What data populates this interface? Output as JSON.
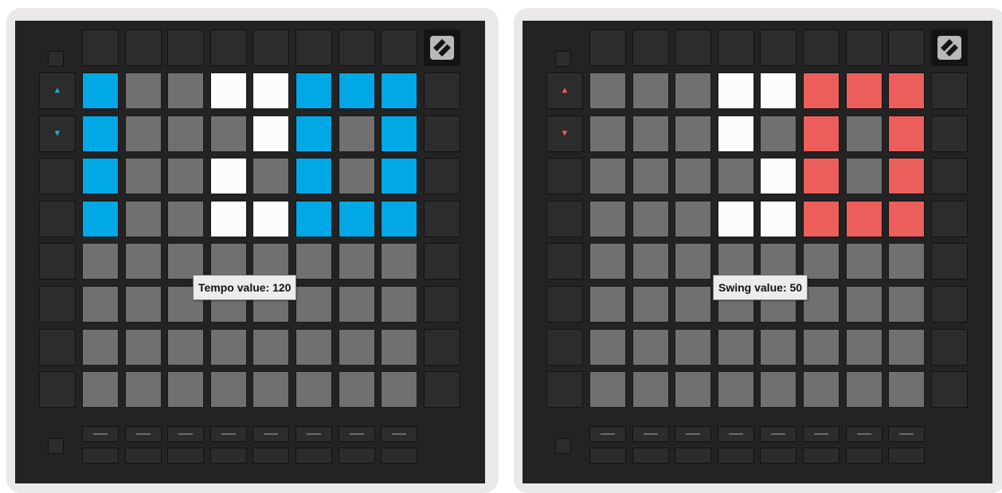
{
  "panels": [
    {
      "id": "tempo",
      "accent": "#00a8e6",
      "arrow_color": "#1fa6de",
      "tooltip": "Tempo value: 120",
      "rows": [
        "ADDNNAAA",
        "ADDDNADA",
        "ADDNDADA",
        "ADDNNAAA",
        "DDDDDDDD",
        "DDDDDDDD",
        "DDDDDDDD",
        "DDDDDDDD"
      ]
    },
    {
      "id": "swing",
      "accent": "#ec5e5b",
      "arrow_color": "#ec5e5b",
      "tooltip": "Swing value: 50",
      "rows": [
        "DDDNNAAA",
        "DDDNDADA",
        "DDDDNADA",
        "DDDNNAAA",
        "DDDDDDDD",
        "DDDDDDDD",
        "DDDDDDDD",
        "DDDDDDDD"
      ]
    }
  ],
  "icons": {
    "up_arrow": "▲",
    "down_arrow": "▼",
    "logo": "novation-logo-icon"
  }
}
